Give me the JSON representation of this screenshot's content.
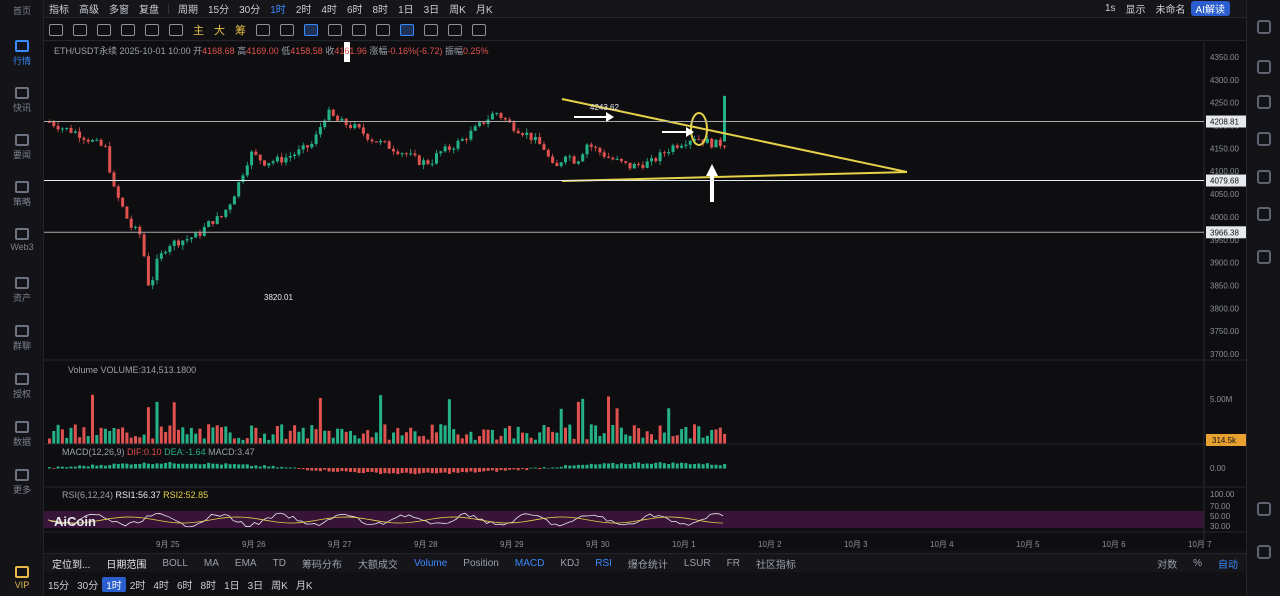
{
  "sidebar": {
    "home": "首页",
    "items": [
      "行情",
      "快讯",
      "要闻",
      "策略",
      "Web3",
      "资产",
      "群聊",
      "授权",
      "数据",
      "更多"
    ],
    "vip": "VIP"
  },
  "topbar": {
    "items": [
      "指标",
      "高级",
      "多窗",
      "复盘",
      "周期",
      "15分",
      "30分",
      "1时",
      "2时",
      "4时",
      "6时",
      "8时",
      "1日",
      "3日",
      "周K",
      "月K"
    ],
    "selected": "1时",
    "right": {
      "interval": "1s",
      "display": "显示",
      "name": "未命名",
      "ai": "AI解读"
    }
  },
  "toolbar": {
    "texts": [
      "主",
      "大",
      "筹"
    ]
  },
  "legend": {
    "symbol": "ETH/USDT永续",
    "date": "2025-10-01 10:00",
    "open_label": "开",
    "open": "4168.68",
    "high_label": "高",
    "high": "4169.00",
    "low_label": "低",
    "low": "4158.58",
    "close_label": "收",
    "close": "4161.96",
    "change_label": "涨幅",
    "change": "-0.16%(-6.72)",
    "amp_label": "振幅",
    "amp": "0.25%"
  },
  "volume_legend": {
    "name": "Volume",
    "value": "VOLUME:314,513.1800"
  },
  "macd_legend": {
    "name": "MACD(12,26,9)",
    "dif": "DIF:0.10",
    "dea": "DEA:-1.64",
    "macd": "MACD:3.47"
  },
  "rsi_legend": {
    "name": "RSI(6,12,24)",
    "rsi1": "RSI1:56.37",
    "rsi2": "RSI2:52.85"
  },
  "watermark": "AiCoin",
  "annotations": {
    "high_label": "4243.62",
    "low_label": "3820.01"
  },
  "price_axis": {
    "ticks": [
      "4350.00",
      "4300.00",
      "4250.00",
      "4200.00",
      "4150.00",
      "4100.00",
      "4050.00",
      "4000.00",
      "3950.00",
      "3900.00",
      "3850.00",
      "3800.00",
      "3750.00",
      "3700.00"
    ],
    "tags": [
      "4208.81",
      "4079.68",
      "3966.38"
    ]
  },
  "volume_axis": {
    "tick": "5.00M",
    "tag": "314.5k"
  },
  "macd_axis": {
    "tick": "0.00"
  },
  "rsi_axis": {
    "ticks": [
      "100.00",
      "70.00",
      "50.00",
      "30.00"
    ]
  },
  "date_axis": [
    "9月 25",
    "9月 26",
    "9月 27",
    "9月 28",
    "9月 29",
    "9月 30",
    "10月 1",
    "10月 2",
    "10月 3",
    "10月 4",
    "10月 5",
    "10月 6",
    "10月 7"
  ],
  "bottombar": {
    "items": [
      "定位到...",
      "日期范围",
      "BOLL",
      "MA",
      "EMA",
      "TD",
      "筹码分布",
      "大额成交",
      "Volume",
      "Position",
      "MACD",
      "KDJ",
      "RSI",
      "爆仓统计",
      "LSUR",
      "FR",
      "社区指标"
    ],
    "right": [
      "对数",
      "%",
      "自动"
    ]
  },
  "bottombar2": {
    "items": [
      "15分",
      "30分",
      "1时",
      "2时",
      "4时",
      "6时",
      "8时",
      "1日",
      "3日",
      "周K",
      "月K"
    ],
    "selected": "1时"
  },
  "colors": {
    "up": "#25b187",
    "down": "#e0524f",
    "accent": "#3a8bff",
    "trendline": "#e6d24a"
  }
}
